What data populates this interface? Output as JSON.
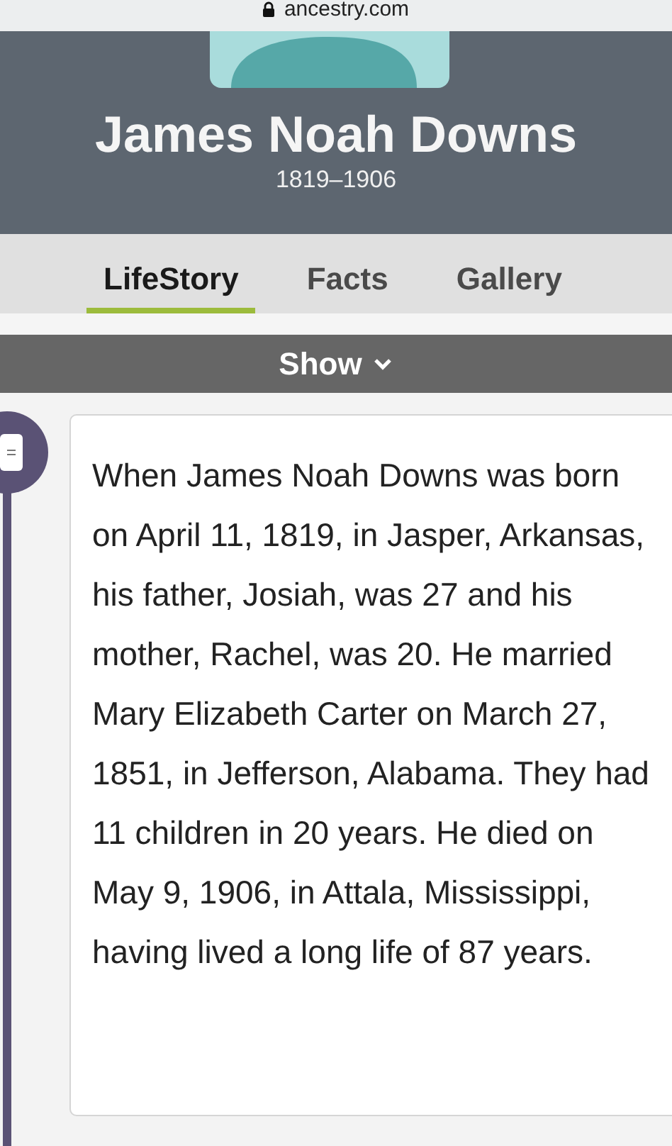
{
  "address_bar": {
    "url": "ancestry.com"
  },
  "profile": {
    "name": "James Noah Downs",
    "years": "1819–1906"
  },
  "tabs": [
    {
      "label": "LifeStory",
      "selected": true
    },
    {
      "label": "Facts",
      "selected": false
    },
    {
      "label": "Gallery",
      "selected": false
    }
  ],
  "show_bar": {
    "label": "Show"
  },
  "story": {
    "text": "When James Noah Downs was born on April 11, 1819, in Jasper, Arkansas, his father, Josiah, was 27 and his mother, Rachel, was 20. He married Mary Elizabeth Carter on March 27, 1851, in Jefferson, Alabama. They had 11 children in 20 years. He died on May 9, 1906, in Attala, Mississippi, having lived a long life of 87 years."
  }
}
